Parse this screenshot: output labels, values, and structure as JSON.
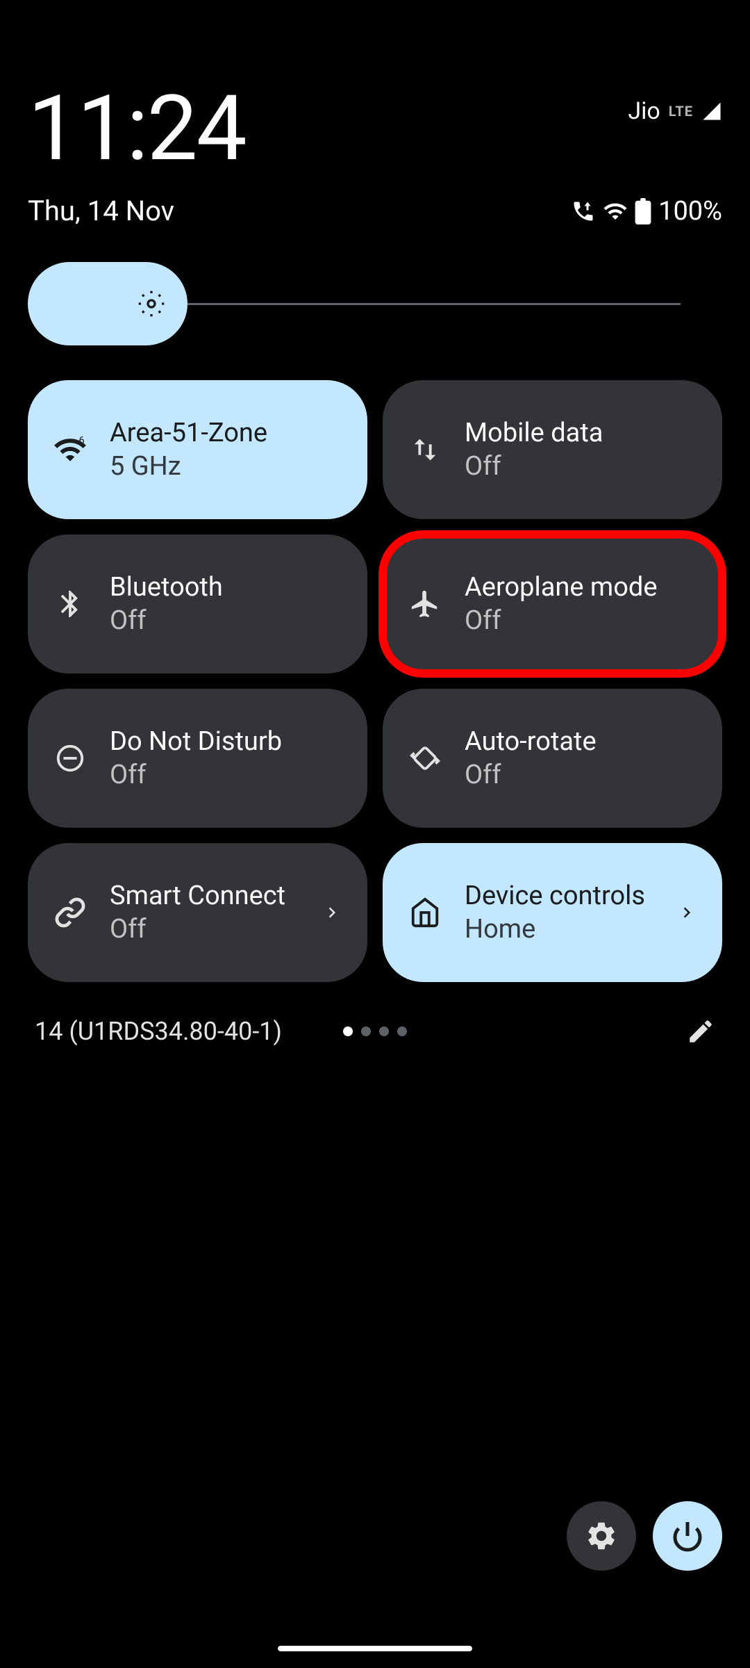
{
  "status": {
    "time": "11:24",
    "date": "Thu, 14 Nov",
    "carrier": "Jio",
    "network_type": "LTE",
    "battery": "100%"
  },
  "brightness": {
    "level_percent": 22
  },
  "tiles": [
    {
      "id": "wifi",
      "icon": "wifi-icon",
      "title": "Area-51-Zone",
      "sub": "5 GHz",
      "active": true,
      "highlight": false,
      "chevron": false
    },
    {
      "id": "mobile-data",
      "icon": "data-arrows-icon",
      "title": "Mobile data",
      "sub": "Off",
      "active": false,
      "highlight": false,
      "chevron": false
    },
    {
      "id": "bluetooth",
      "icon": "bluetooth-icon",
      "title": "Bluetooth",
      "sub": "Off",
      "active": false,
      "highlight": false,
      "chevron": false
    },
    {
      "id": "airplane",
      "icon": "airplane-icon",
      "title": "Aeroplane mode",
      "sub": "Off",
      "active": false,
      "highlight": true,
      "chevron": false
    },
    {
      "id": "dnd",
      "icon": "dnd-icon",
      "title": "Do Not Disturb",
      "sub": "Off",
      "active": false,
      "highlight": false,
      "chevron": false
    },
    {
      "id": "rotate",
      "icon": "rotate-icon",
      "title": "Auto-rotate",
      "sub": "Off",
      "active": false,
      "highlight": false,
      "chevron": false
    },
    {
      "id": "smart-connect",
      "icon": "link-icon",
      "title": "Smart Connect",
      "sub": "Off",
      "active": false,
      "highlight": false,
      "chevron": true
    },
    {
      "id": "device-controls",
      "icon": "home-icon",
      "title": "Device controls",
      "sub": "Home",
      "active": true,
      "highlight": false,
      "chevron": true
    }
  ],
  "footer": {
    "build": "14 (U1RDS34.80-40-1)",
    "page_count": 4,
    "current_page": 0
  },
  "colors": {
    "accent": "#c2e7ff",
    "tile_inactive": "#333438",
    "highlight": "#ff0000"
  }
}
